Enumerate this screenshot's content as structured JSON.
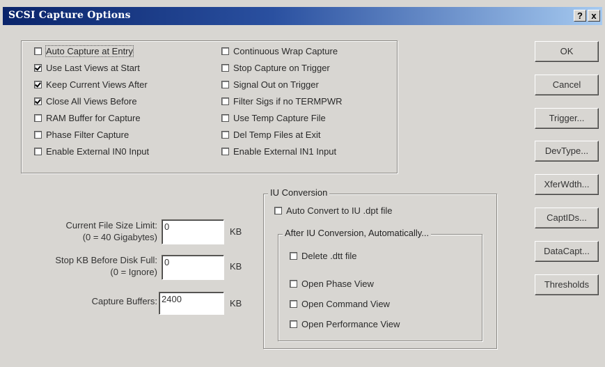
{
  "dialog": {
    "title": "SCSI Capture Options"
  },
  "titlebar": {
    "help": "?",
    "close": "x"
  },
  "options": {
    "left": [
      {
        "label": "Auto Capture at Entry",
        "checked": false
      },
      {
        "label": "Use Last Views at Start",
        "checked": true
      },
      {
        "label": "Keep Current Views After",
        "checked": true
      },
      {
        "label": "Close All Views Before",
        "checked": true
      },
      {
        "label": "RAM Buffer for Capture",
        "checked": false
      },
      {
        "label": "Phase Filter Capture",
        "checked": false
      },
      {
        "label": "Enable External IN0 Input",
        "checked": false
      }
    ],
    "right": [
      {
        "label": "Continuous Wrap Capture",
        "checked": false
      },
      {
        "label": "Stop Capture on Trigger",
        "checked": false
      },
      {
        "label": "Signal Out on Trigger",
        "checked": false
      },
      {
        "label": "Filter Sigs if no TERMPWR",
        "checked": false
      },
      {
        "label": "Use Temp Capture File",
        "checked": false
      },
      {
        "label": "Del Temp Files at Exit",
        "checked": false
      },
      {
        "label": "Enable External IN1 Input",
        "checked": false
      }
    ]
  },
  "buttons": {
    "ok": "OK",
    "cancel": "Cancel",
    "trigger": "Trigger...",
    "devtype": "DevType...",
    "xferwidth": "XferWdth...",
    "captids": "CaptIDs...",
    "datacapt": "DataCapt...",
    "thresholds": "Thresholds"
  },
  "fields": {
    "file_size": {
      "label": "Current File Size Limit:",
      "sublabel": "(0 = 40 Gigabytes)",
      "value": "0",
      "unit": "KB"
    },
    "stop_kb": {
      "label": "Stop KB Before Disk Full:",
      "sublabel": "(0 = Ignore)",
      "value": "0",
      "unit": "KB"
    },
    "capture_buffers": {
      "label": "Capture Buffers:",
      "value": "2400",
      "unit": "KB"
    }
  },
  "iu_conversion": {
    "title": "IU Conversion",
    "auto_convert": {
      "label": "Auto Convert to IU .dpt file",
      "checked": false
    },
    "after_title": "After IU Conversion, Automatically...",
    "after_options": [
      {
        "label": "Delete .dtt file",
        "checked": false
      },
      {
        "label": "Open Phase View",
        "checked": false
      },
      {
        "label": "Open Command View",
        "checked": false
      },
      {
        "label": "Open Performance View",
        "checked": false
      }
    ]
  }
}
